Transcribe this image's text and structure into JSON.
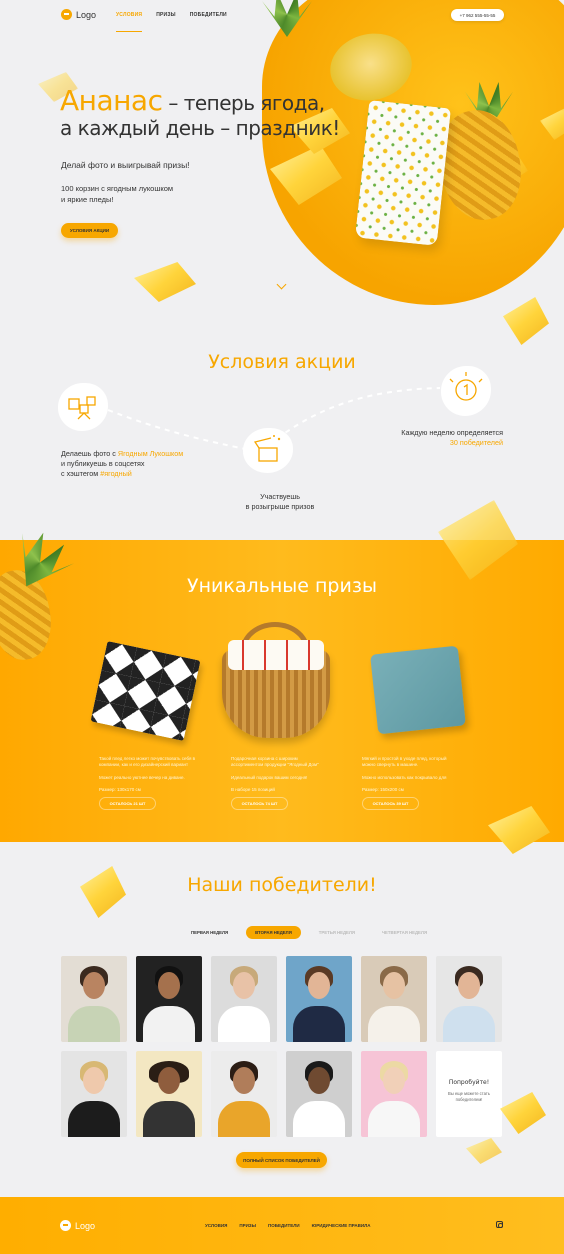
{
  "colors": {
    "accent": "#f7a700",
    "background": "#f0f0f2",
    "text": "#333333"
  },
  "header": {
    "logo_text": "Logo",
    "nav": [
      "УСЛОВИЯ",
      "ПРИЗЫ",
      "ПОБЕДИТЕЛИ"
    ],
    "phone": "+7 962 555-55-55"
  },
  "hero": {
    "title_accent": "Ананас",
    "title_rest_1": " – теперь ягода,",
    "title_line_2": "а каждый день – праздник!",
    "subtitle": "Делай фото и выигрывай призы!",
    "desc_line_1": "100 корзин с ягодным лукошком",
    "desc_line_2": "и яркие пледы!",
    "button": "УСЛОВИЯ АКЦИИ"
  },
  "conditions": {
    "title": "Условия акции",
    "step1": {
      "pre": "Делаешь фото с ",
      "brand": "Ягодным Лукошком",
      "line2": "и публикуешь в соцсетях",
      "line3_pre": "с хэштегом ",
      "hashtag": "#ягодный"
    },
    "step2": {
      "line1": "Участвуешь",
      "line2": "в розыгрыше призов"
    },
    "step3": {
      "line1": "Каждую неделю определяется",
      "line2": "30 победителей"
    }
  },
  "prizes": {
    "title": "Уникальные призы",
    "items": [
      {
        "desc1": "Такой плед легко может почувствовать себя в",
        "desc2": "компании, как и его дизайнерский вариант",
        "desc3": "Может реально уютнее вечер на диване.",
        "size": "Размер: 130х170 см",
        "button": "ОСТАЛОСЬ 21 ШТ"
      },
      {
        "desc1": "Подарочная корзина с широким",
        "desc2": "ассортиментом продукции \"Ягодный Дом\"",
        "desc3": "Идеальный подарок вашим сегодня!",
        "size": "В наборе 15 позиций",
        "button": "ОСТАЛОСЬ 74 ШТ"
      },
      {
        "desc1": "Мягкий и простой в уходе плед, который",
        "desc2": "можно свернуть в машине.",
        "desc3": "Можно использовать как покрывало для",
        "size": "Размер: 150х200 см",
        "button": "ОСТАЛОСЬ 39 ШТ"
      }
    ]
  },
  "winners": {
    "title": "Наши победители!",
    "tabs": [
      "ПЕРВАЯ НЕДЕЛЯ",
      "ВТОРАЯ НЕДЕЛЯ",
      "ТРЕТЬЯ НЕДЕЛЯ",
      "ЧЕТВЕРТАЯ НЕДЕЛЯ"
    ],
    "active_tab": 1,
    "join_title": "Попробуйте!",
    "join_text": "Вы еще можете стать победителем!",
    "full_list_button": "ПОЛНЫЙ СПИСОК ПОБЕДИТЕЛЕЙ"
  },
  "footer": {
    "logo_text": "Logo",
    "nav": [
      "УСЛОВИЯ",
      "ПРИЗЫ",
      "ПОБЕДИТЕЛИ",
      "ЮРИДИЧЕСКИЕ ПРАВИЛА"
    ],
    "social_icon": "instagram-icon"
  }
}
